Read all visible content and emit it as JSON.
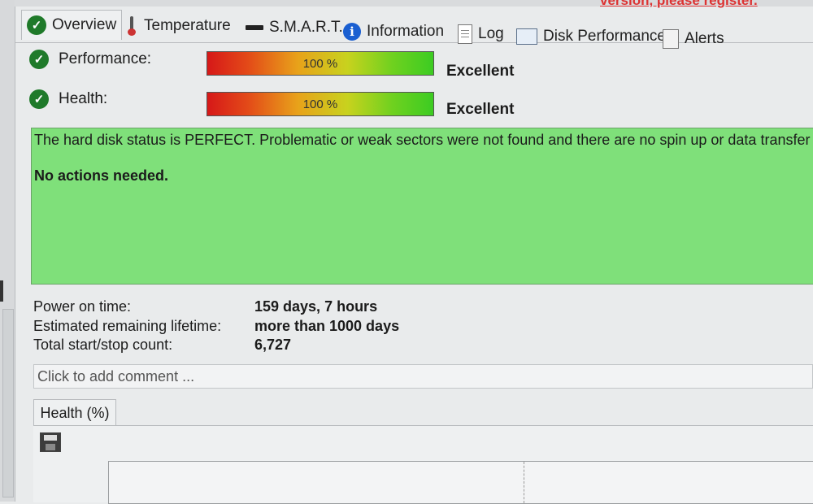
{
  "header": {
    "register_text": "version, please register."
  },
  "tabs": [
    {
      "label": "Overview",
      "icon": "check-icon",
      "active": true
    },
    {
      "label": "Temperature",
      "icon": "thermometer-icon"
    },
    {
      "label": "S.M.A.R.T.",
      "icon": "drive-icon"
    },
    {
      "label": "Information",
      "icon": "info-icon"
    },
    {
      "label": "Log",
      "icon": "document-icon"
    },
    {
      "label": "Disk Performance",
      "icon": "chart-icon"
    },
    {
      "label": "Alerts",
      "icon": "alerts-icon"
    }
  ],
  "performance": {
    "label": "Performance:",
    "value_text": "100 %",
    "value": 100,
    "rating": "Excellent"
  },
  "health": {
    "label": "Health:",
    "value_text": "100 %",
    "value": 100,
    "rating": "Excellent"
  },
  "status": {
    "text": "The hard disk status is PERFECT. Problematic or weak sectors were not found and there are no spin up or data transfer errors",
    "action": "No actions needed.",
    "color": "#7fe07a"
  },
  "info": [
    {
      "key": "Power on time:",
      "value": "159 days, 7 hours"
    },
    {
      "key": "Estimated remaining lifetime:",
      "value": "more than 1000 days"
    },
    {
      "key": "Total start/stop count:",
      "value": "6,727"
    }
  ],
  "comment": {
    "placeholder": "Click to add comment ..."
  },
  "health_chart": {
    "tab_label": "Health (%)",
    "save_icon": "save-icon"
  }
}
